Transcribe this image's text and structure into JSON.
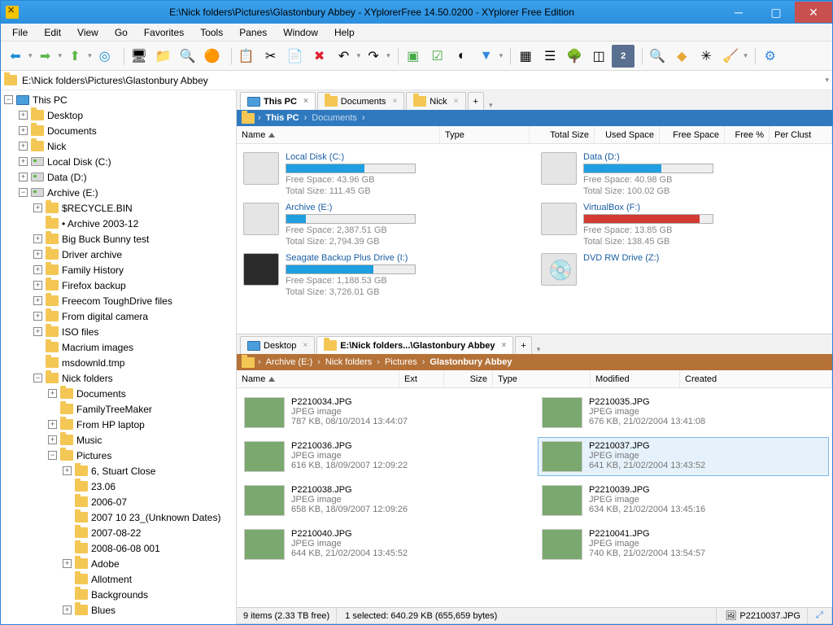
{
  "window": {
    "title": "E:\\Nick folders\\Pictures\\Glastonbury Abbey - XYplorerFree 14.50.0200 - XYplorer Free Edition"
  },
  "menu": [
    "File",
    "Edit",
    "View",
    "Go",
    "Favorites",
    "Tools",
    "Panes",
    "Window",
    "Help"
  ],
  "address": "E:\\Nick folders\\Pictures\\Glastonbury Abbey",
  "tree": [
    {
      "d": 0,
      "exp": "-",
      "icon": "pc",
      "label": "This PC"
    },
    {
      "d": 1,
      "exp": "+",
      "icon": "folder",
      "label": "Desktop"
    },
    {
      "d": 1,
      "exp": "+",
      "icon": "folder",
      "label": "Documents"
    },
    {
      "d": 1,
      "exp": "+",
      "icon": "folder",
      "label": "Nick"
    },
    {
      "d": 1,
      "exp": "+",
      "icon": "drive",
      "label": "Local Disk (C:)"
    },
    {
      "d": 1,
      "exp": "+",
      "icon": "drive",
      "label": "Data (D:)"
    },
    {
      "d": 1,
      "exp": "-",
      "icon": "drive",
      "label": "Archive (E:)"
    },
    {
      "d": 2,
      "exp": "+",
      "icon": "folder",
      "label": "$RECYCLE.BIN"
    },
    {
      "d": 2,
      "exp": "",
      "icon": "folder",
      "label": "• Archive 2003-12"
    },
    {
      "d": 2,
      "exp": "+",
      "icon": "folder",
      "label": "Big Buck Bunny test"
    },
    {
      "d": 2,
      "exp": "+",
      "icon": "folder",
      "label": "Driver archive"
    },
    {
      "d": 2,
      "exp": "+",
      "icon": "folder",
      "label": "Family History"
    },
    {
      "d": 2,
      "exp": "+",
      "icon": "folder",
      "label": "Firefox backup"
    },
    {
      "d": 2,
      "exp": "+",
      "icon": "folder",
      "label": "Freecom ToughDrive files"
    },
    {
      "d": 2,
      "exp": "+",
      "icon": "folder",
      "label": "From digital camera"
    },
    {
      "d": 2,
      "exp": "+",
      "icon": "folder",
      "label": "ISO files"
    },
    {
      "d": 2,
      "exp": "",
      "icon": "folder",
      "label": "Macrium images"
    },
    {
      "d": 2,
      "exp": "",
      "icon": "folder",
      "label": "msdownld.tmp"
    },
    {
      "d": 2,
      "exp": "-",
      "icon": "folder",
      "label": "Nick folders"
    },
    {
      "d": 3,
      "exp": "+",
      "icon": "folder",
      "label": "Documents"
    },
    {
      "d": 3,
      "exp": "",
      "icon": "folder",
      "label": "FamilyTreeMaker"
    },
    {
      "d": 3,
      "exp": "+",
      "icon": "folder",
      "label": "From HP laptop"
    },
    {
      "d": 3,
      "exp": "+",
      "icon": "folder",
      "label": "Music"
    },
    {
      "d": 3,
      "exp": "-",
      "icon": "folder",
      "label": "Pictures"
    },
    {
      "d": 4,
      "exp": "+",
      "icon": "folder",
      "label": "6, Stuart Close"
    },
    {
      "d": 4,
      "exp": "",
      "icon": "folder",
      "label": "23.06"
    },
    {
      "d": 4,
      "exp": "",
      "icon": "folder",
      "label": "2006-07"
    },
    {
      "d": 4,
      "exp": "",
      "icon": "folder",
      "label": "2007 10 23_(Unknown Dates)"
    },
    {
      "d": 4,
      "exp": "",
      "icon": "folder",
      "label": "2007-08-22"
    },
    {
      "d": 4,
      "exp": "",
      "icon": "folder",
      "label": "2008-06-08 001"
    },
    {
      "d": 4,
      "exp": "+",
      "icon": "folder",
      "label": "Adobe"
    },
    {
      "d": 4,
      "exp": "",
      "icon": "folder",
      "label": "Allotment"
    },
    {
      "d": 4,
      "exp": "",
      "icon": "folder",
      "label": "Backgrounds"
    },
    {
      "d": 4,
      "exp": "+",
      "icon": "folder",
      "label": "Blues"
    }
  ],
  "topPane": {
    "tabs": [
      {
        "label": "This PC",
        "active": true,
        "icon": "pc"
      },
      {
        "label": "Documents",
        "active": false,
        "icon": "folder"
      },
      {
        "label": "Nick",
        "active": false,
        "icon": "folder"
      }
    ],
    "crumbs": [
      "This PC",
      "Documents"
    ],
    "columns": [
      "Name",
      "Type",
      "Total Size",
      "Used Space",
      "Free Space",
      "Free %",
      "Per Clust"
    ],
    "drives": [
      {
        "name": "Local Disk (C:)",
        "fill": 61,
        "free": "Free Space: 43.96 GB",
        "total": "Total Size: 111.45 GB",
        "img": "hd"
      },
      {
        "name": "Data (D:)",
        "fill": 60,
        "free": "Free Space: 40.98 GB",
        "total": "Total Size: 100.02 GB",
        "img": "hd"
      },
      {
        "name": "Archive (E:)",
        "fill": 15,
        "free": "Free Space: 2,387.51 GB",
        "total": "Total Size: 2,794.39 GB",
        "img": "hd"
      },
      {
        "name": "VirtualBox (F:)",
        "fill": 90,
        "free": "Free Space: 13.85 GB",
        "total": "Total Size: 138.45 GB",
        "img": "hd",
        "red": true
      },
      {
        "name": "Seagate Backup Plus Drive (I:)",
        "fill": 68,
        "free": "Free Space: 1,188.53 GB",
        "total": "Total Size: 3,726.01 GB",
        "img": "ext"
      },
      {
        "name": "DVD RW Drive (Z:)",
        "fill": 0,
        "free": "",
        "total": "",
        "img": "dvd",
        "nobar": true
      }
    ]
  },
  "bottomPane": {
    "tabs": [
      {
        "label": "Desktop",
        "active": false,
        "icon": "pc"
      },
      {
        "label": "E:\\Nick folders...\\Glastonbury Abbey",
        "active": true,
        "icon": "folder"
      }
    ],
    "crumbs": [
      "Archive (E:)",
      "Nick folders",
      "Pictures",
      "Glastonbury Abbey"
    ],
    "columns": [
      "Name",
      "Ext",
      "Size",
      "Type",
      "Modified",
      "Created"
    ],
    "files": [
      {
        "name": "P2210034.JPG",
        "type": "JPEG image",
        "meta": "787 KB, 08/10/2014 13:44:07"
      },
      {
        "name": "P2210035.JPG",
        "type": "JPEG image",
        "meta": "676 KB, 21/02/2004 13:41:08"
      },
      {
        "name": "P2210036.JPG",
        "type": "JPEG image",
        "meta": "616 KB, 18/09/2007 12:09:22"
      },
      {
        "name": "P2210037.JPG",
        "type": "JPEG image",
        "meta": "641 KB, 21/02/2004 13:43:52",
        "sel": true
      },
      {
        "name": "P2210038.JPG",
        "type": "JPEG image",
        "meta": "658 KB, 18/09/2007 12:09:26"
      },
      {
        "name": "P2210039.JPG",
        "type": "JPEG image",
        "meta": "634 KB, 21/02/2004 13:45:16"
      },
      {
        "name": "P2210040.JPG",
        "type": "JPEG image",
        "meta": "644 KB, 21/02/2004 13:45:52"
      },
      {
        "name": "P2210041.JPG",
        "type": "JPEG image",
        "meta": "740 KB, 21/02/2004 13:54:57"
      }
    ]
  },
  "status": {
    "items": "9 items (2.33 TB free)",
    "selected": "1 selected: 640.29 KB (655,659 bytes)",
    "file": "P2210037.JPG"
  }
}
